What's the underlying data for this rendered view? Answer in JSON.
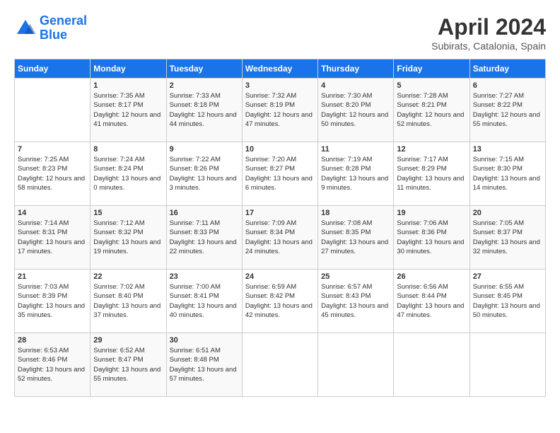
{
  "logo": {
    "line1": "General",
    "line2": "Blue"
  },
  "title": "April 2024",
  "location": "Subirats, Catalonia, Spain",
  "days_of_week": [
    "Sunday",
    "Monday",
    "Tuesday",
    "Wednesday",
    "Thursday",
    "Friday",
    "Saturday"
  ],
  "weeks": [
    [
      {
        "day": "",
        "sunrise": "",
        "sunset": "",
        "daylight": ""
      },
      {
        "day": "1",
        "sunrise": "Sunrise: 7:35 AM",
        "sunset": "Sunset: 8:17 PM",
        "daylight": "Daylight: 12 hours and 41 minutes."
      },
      {
        "day": "2",
        "sunrise": "Sunrise: 7:33 AM",
        "sunset": "Sunset: 8:18 PM",
        "daylight": "Daylight: 12 hours and 44 minutes."
      },
      {
        "day": "3",
        "sunrise": "Sunrise: 7:32 AM",
        "sunset": "Sunset: 8:19 PM",
        "daylight": "Daylight: 12 hours and 47 minutes."
      },
      {
        "day": "4",
        "sunrise": "Sunrise: 7:30 AM",
        "sunset": "Sunset: 8:20 PM",
        "daylight": "Daylight: 12 hours and 50 minutes."
      },
      {
        "day": "5",
        "sunrise": "Sunrise: 7:28 AM",
        "sunset": "Sunset: 8:21 PM",
        "daylight": "Daylight: 12 hours and 52 minutes."
      },
      {
        "day": "6",
        "sunrise": "Sunrise: 7:27 AM",
        "sunset": "Sunset: 8:22 PM",
        "daylight": "Daylight: 12 hours and 55 minutes."
      }
    ],
    [
      {
        "day": "7",
        "sunrise": "Sunrise: 7:25 AM",
        "sunset": "Sunset: 8:23 PM",
        "daylight": "Daylight: 12 hours and 58 minutes."
      },
      {
        "day": "8",
        "sunrise": "Sunrise: 7:24 AM",
        "sunset": "Sunset: 8:24 PM",
        "daylight": "Daylight: 13 hours and 0 minutes."
      },
      {
        "day": "9",
        "sunrise": "Sunrise: 7:22 AM",
        "sunset": "Sunset: 8:26 PM",
        "daylight": "Daylight: 13 hours and 3 minutes."
      },
      {
        "day": "10",
        "sunrise": "Sunrise: 7:20 AM",
        "sunset": "Sunset: 8:27 PM",
        "daylight": "Daylight: 13 hours and 6 minutes."
      },
      {
        "day": "11",
        "sunrise": "Sunrise: 7:19 AM",
        "sunset": "Sunset: 8:28 PM",
        "daylight": "Daylight: 13 hours and 9 minutes."
      },
      {
        "day": "12",
        "sunrise": "Sunrise: 7:17 AM",
        "sunset": "Sunset: 8:29 PM",
        "daylight": "Daylight: 13 hours and 11 minutes."
      },
      {
        "day": "13",
        "sunrise": "Sunrise: 7:15 AM",
        "sunset": "Sunset: 8:30 PM",
        "daylight": "Daylight: 13 hours and 14 minutes."
      }
    ],
    [
      {
        "day": "14",
        "sunrise": "Sunrise: 7:14 AM",
        "sunset": "Sunset: 8:31 PM",
        "daylight": "Daylight: 13 hours and 17 minutes."
      },
      {
        "day": "15",
        "sunrise": "Sunrise: 7:12 AM",
        "sunset": "Sunset: 8:32 PM",
        "daylight": "Daylight: 13 hours and 19 minutes."
      },
      {
        "day": "16",
        "sunrise": "Sunrise: 7:11 AM",
        "sunset": "Sunset: 8:33 PM",
        "daylight": "Daylight: 13 hours and 22 minutes."
      },
      {
        "day": "17",
        "sunrise": "Sunrise: 7:09 AM",
        "sunset": "Sunset: 8:34 PM",
        "daylight": "Daylight: 13 hours and 24 minutes."
      },
      {
        "day": "18",
        "sunrise": "Sunrise: 7:08 AM",
        "sunset": "Sunset: 8:35 PM",
        "daylight": "Daylight: 13 hours and 27 minutes."
      },
      {
        "day": "19",
        "sunrise": "Sunrise: 7:06 AM",
        "sunset": "Sunset: 8:36 PM",
        "daylight": "Daylight: 13 hours and 30 minutes."
      },
      {
        "day": "20",
        "sunrise": "Sunrise: 7:05 AM",
        "sunset": "Sunset: 8:37 PM",
        "daylight": "Daylight: 13 hours and 32 minutes."
      }
    ],
    [
      {
        "day": "21",
        "sunrise": "Sunrise: 7:03 AM",
        "sunset": "Sunset: 8:39 PM",
        "daylight": "Daylight: 13 hours and 35 minutes."
      },
      {
        "day": "22",
        "sunrise": "Sunrise: 7:02 AM",
        "sunset": "Sunset: 8:40 PM",
        "daylight": "Daylight: 13 hours and 37 minutes."
      },
      {
        "day": "23",
        "sunrise": "Sunrise: 7:00 AM",
        "sunset": "Sunset: 8:41 PM",
        "daylight": "Daylight: 13 hours and 40 minutes."
      },
      {
        "day": "24",
        "sunrise": "Sunrise: 6:59 AM",
        "sunset": "Sunset: 8:42 PM",
        "daylight": "Daylight: 13 hours and 42 minutes."
      },
      {
        "day": "25",
        "sunrise": "Sunrise: 6:57 AM",
        "sunset": "Sunset: 8:43 PM",
        "daylight": "Daylight: 13 hours and 45 minutes."
      },
      {
        "day": "26",
        "sunrise": "Sunrise: 6:56 AM",
        "sunset": "Sunset: 8:44 PM",
        "daylight": "Daylight: 13 hours and 47 minutes."
      },
      {
        "day": "27",
        "sunrise": "Sunrise: 6:55 AM",
        "sunset": "Sunset: 8:45 PM",
        "daylight": "Daylight: 13 hours and 50 minutes."
      }
    ],
    [
      {
        "day": "28",
        "sunrise": "Sunrise: 6:53 AM",
        "sunset": "Sunset: 8:46 PM",
        "daylight": "Daylight: 13 hours and 52 minutes."
      },
      {
        "day": "29",
        "sunrise": "Sunrise: 6:52 AM",
        "sunset": "Sunset: 8:47 PM",
        "daylight": "Daylight: 13 hours and 55 minutes."
      },
      {
        "day": "30",
        "sunrise": "Sunrise: 6:51 AM",
        "sunset": "Sunset: 8:48 PM",
        "daylight": "Daylight: 13 hours and 57 minutes."
      },
      {
        "day": "",
        "sunrise": "",
        "sunset": "",
        "daylight": ""
      },
      {
        "day": "",
        "sunrise": "",
        "sunset": "",
        "daylight": ""
      },
      {
        "day": "",
        "sunrise": "",
        "sunset": "",
        "daylight": ""
      },
      {
        "day": "",
        "sunrise": "",
        "sunset": "",
        "daylight": ""
      }
    ]
  ]
}
